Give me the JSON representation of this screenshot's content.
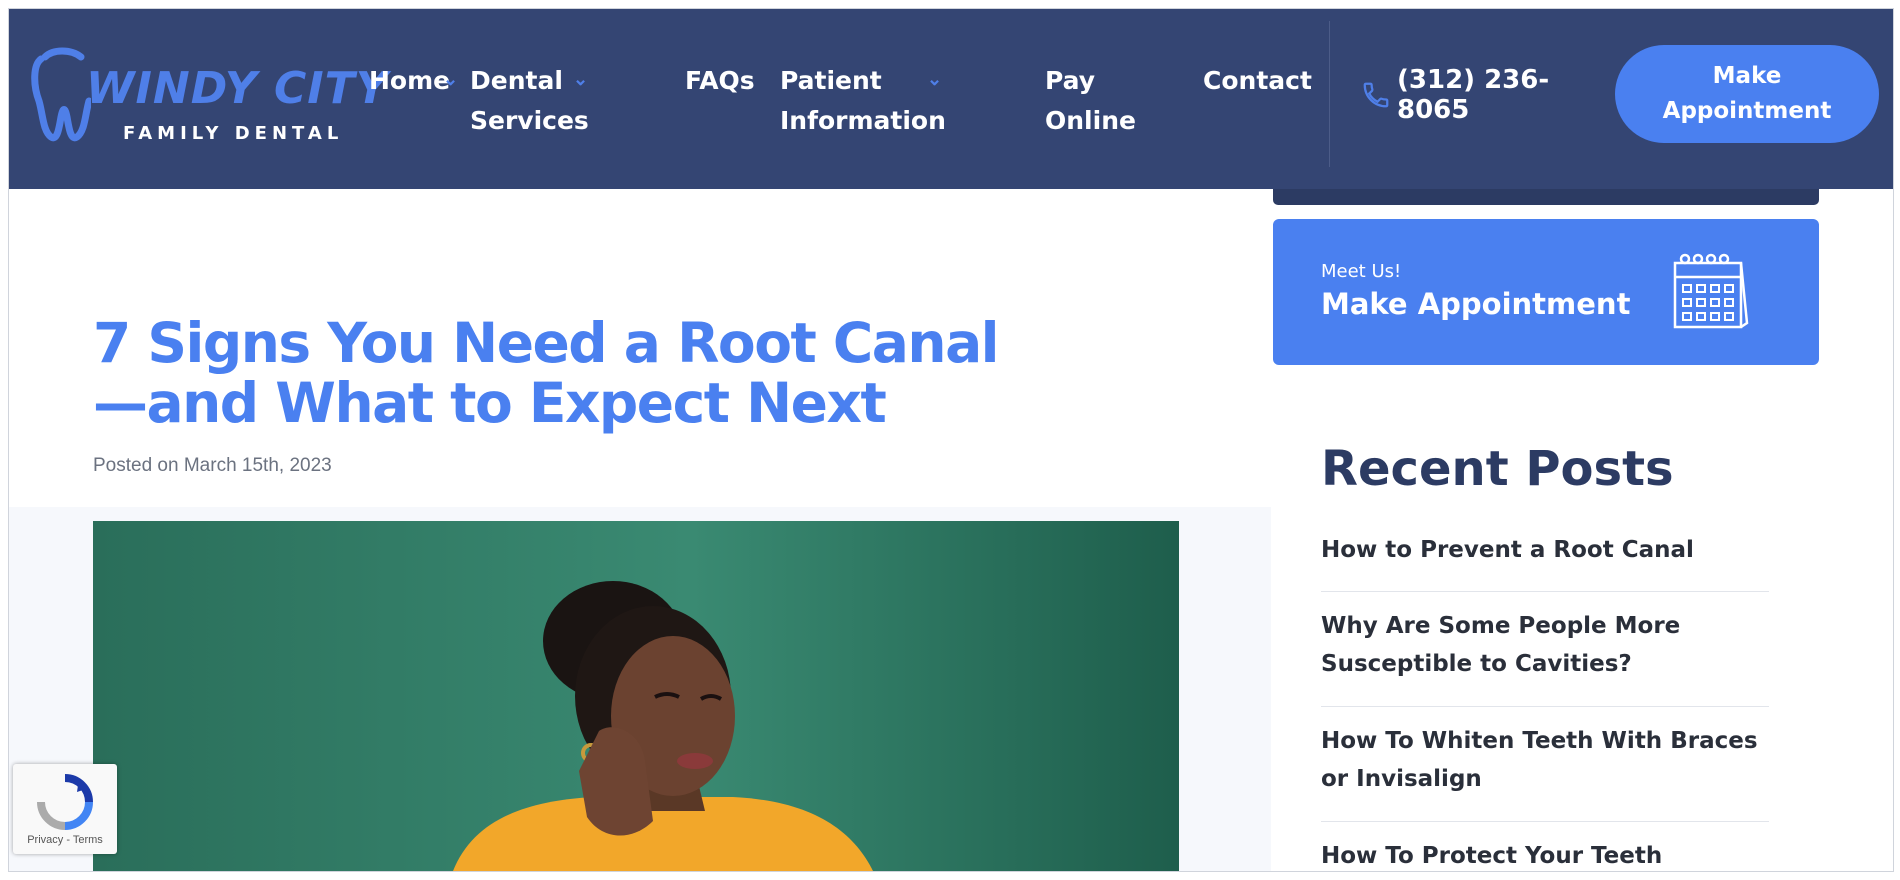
{
  "header": {
    "logo": {
      "main": "WINDY CITY",
      "sub": "FAMILY DENTAL"
    },
    "nav": [
      {
        "label": "Home",
        "has_dropdown": true
      },
      {
        "label": "Dental Services",
        "line1": "Dental",
        "line2": "Services",
        "has_dropdown": true
      },
      {
        "label": "FAQs",
        "has_dropdown": false
      },
      {
        "label": "Patient Information",
        "line1": "Patient",
        "line2": "Information",
        "has_dropdown": true
      },
      {
        "label": "Pay Online",
        "line1": "Pay",
        "line2": "Online",
        "has_dropdown": false
      },
      {
        "label": "Contact",
        "has_dropdown": false
      }
    ],
    "phone": "(312) 236-8065",
    "phone_line1": "(312) 236-",
    "phone_line2": "8065",
    "cta_line1": "Make",
    "cta_line2": "Appointment",
    "icons": {
      "phone": "phone-icon",
      "dropdown": "chevron-down-icon"
    }
  },
  "post": {
    "title": "7 Signs You Need a Root Canal—and What to Expect Next",
    "date": "Posted on March 15th, 2023",
    "hero_alt": "woman holding her cheek in tooth pain"
  },
  "sidebar": {
    "cta": {
      "subtitle": "Meet Us!",
      "title": "Make Appointment",
      "icon": "calendar-icon"
    },
    "recent_title": "Recent Posts",
    "recent_posts": [
      {
        "title": "How to Prevent a Root Canal"
      },
      {
        "title": "Why Are Some People More Susceptible to Cavities?",
        "line1": "Why Are Some People More",
        "line2": "Susceptible to Cavities?"
      },
      {
        "title": "How To Whiten Teeth With Braces or Invisalign",
        "line1": "How To Whiten Teeth With Braces",
        "line2": "or Invisalign"
      },
      {
        "title": "How To Protect Your Teeth"
      }
    ]
  },
  "recaptcha": {
    "links": "Privacy - Terms"
  },
  "colors": {
    "header_bg": "#344573",
    "accent": "#4a80f0",
    "sidebar_dark": "#2c3b63",
    "hero_bg": "#2e7a63",
    "sweater": "#f2a72a"
  }
}
